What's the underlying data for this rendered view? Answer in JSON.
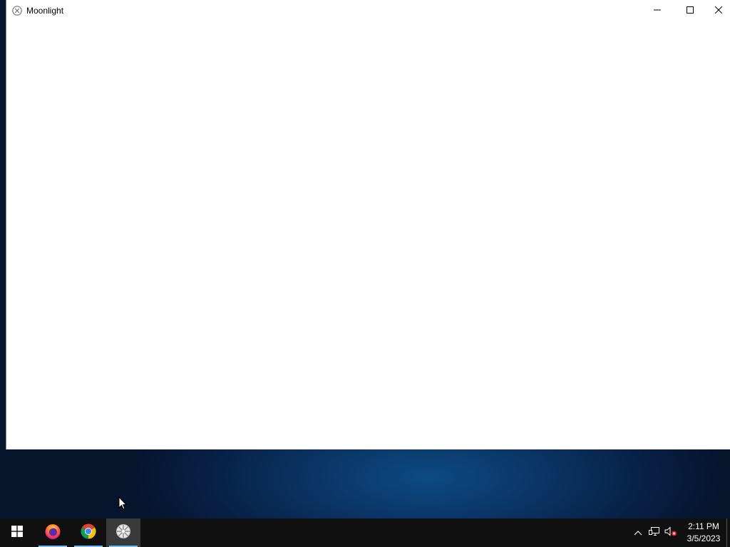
{
  "window": {
    "title": "Moonlight",
    "app_icon": "moonlight-icon",
    "controls": {
      "minimize": "minimize-icon",
      "maximize": "maximize-icon",
      "close": "close-icon"
    }
  },
  "taskbar": {
    "start": "windows-logo-icon",
    "apps": [
      {
        "name": "Firefox",
        "icon": "firefox-icon",
        "running": true
      },
      {
        "name": "Google Chrome",
        "icon": "chrome-icon",
        "running": true
      },
      {
        "name": "Moonlight",
        "icon": "moonlight-icon",
        "running": true,
        "active": true
      }
    ],
    "tray": {
      "chevron": "chevron-up-icon",
      "network": "network-icon",
      "volume": "volume-muted-icon"
    },
    "clock": {
      "time": "2:11 PM",
      "date": "3/5/2023"
    }
  },
  "colors": {
    "taskbar_bg": "#101010",
    "active_indicator": "#76b9ed",
    "desktop_bg": "#081f44"
  }
}
